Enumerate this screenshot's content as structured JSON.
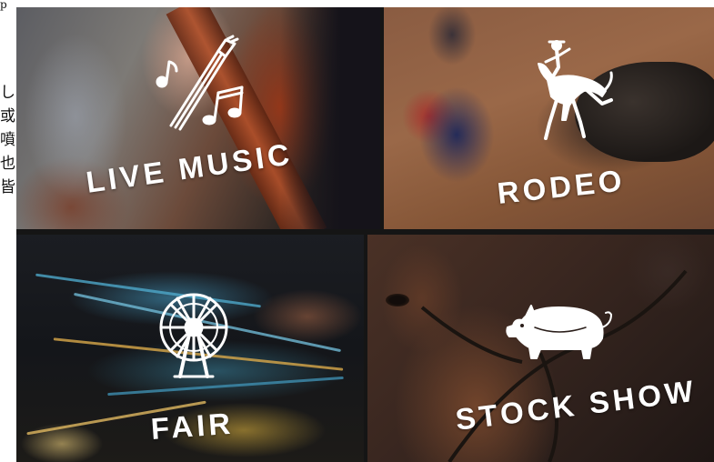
{
  "margin": {
    "top_glyph": "p",
    "side_glyphs": [
      "し",
      "或",
      "噴",
      "也",
      "皆"
    ]
  },
  "tiles": [
    {
      "id": "music",
      "label": "LIVE MUSIC",
      "icon": "guitar-with-notes-icon"
    },
    {
      "id": "rodeo",
      "label": "RODEO",
      "icon": "bucking-horse-rider-icon"
    },
    {
      "id": "fair",
      "label": "FAIR",
      "icon": "ferris-wheel-icon"
    },
    {
      "id": "stock",
      "label": "STOCK SHOW",
      "icon": "pig-icon"
    }
  ],
  "colors": {
    "label": "#ffffff",
    "grid_gap": "#151515"
  }
}
